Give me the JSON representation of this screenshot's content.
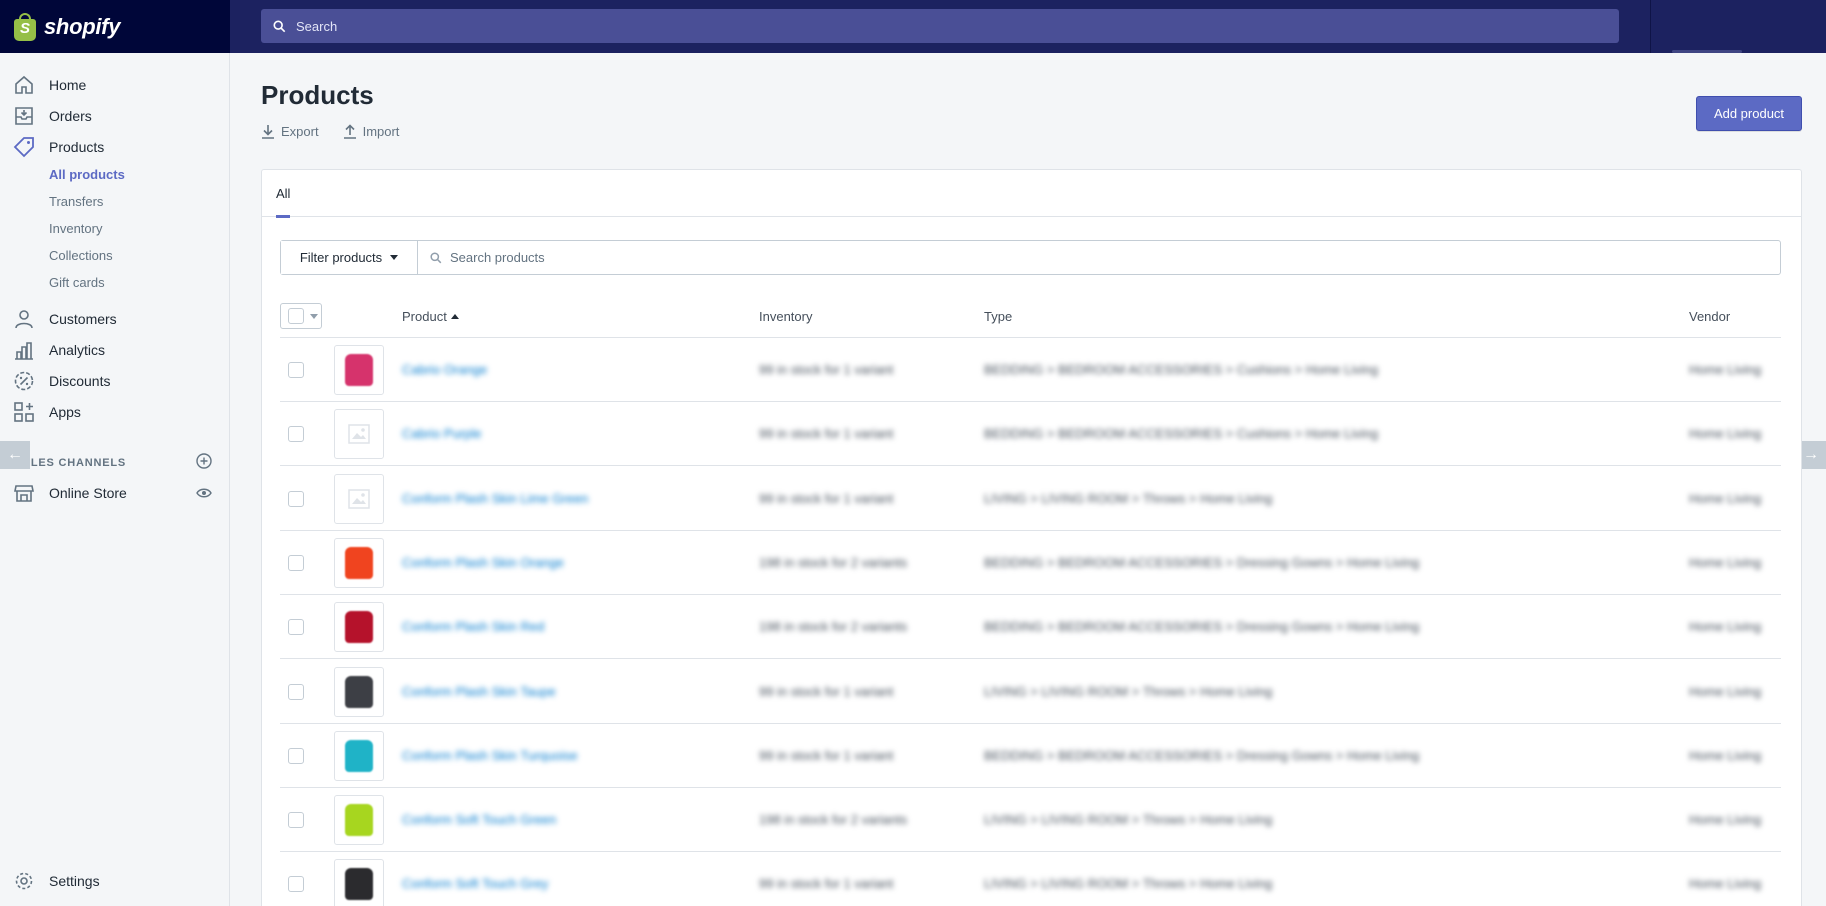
{
  "brand": {
    "name": "shopify",
    "logo_letter": "S"
  },
  "top_search": {
    "placeholder": "Search"
  },
  "sidebar": {
    "items": [
      {
        "label": "Home",
        "icon": "home-icon"
      },
      {
        "label": "Orders",
        "icon": "orders-icon"
      },
      {
        "label": "Products",
        "icon": "tag-icon"
      },
      {
        "label": "Customers",
        "icon": "person-icon"
      },
      {
        "label": "Analytics",
        "icon": "bar-chart-icon"
      },
      {
        "label": "Discounts",
        "icon": "discount-icon"
      },
      {
        "label": "Apps",
        "icon": "apps-icon"
      }
    ],
    "product_subitems": [
      "All products",
      "Transfers",
      "Inventory",
      "Collections",
      "Gift cards"
    ],
    "sales_channels_title": "SALES CHANNELS",
    "online_store": "Online Store",
    "settings": "Settings"
  },
  "page": {
    "title": "Products",
    "export_label": "Export",
    "import_label": "Import",
    "add_button": "Add product",
    "tab_all": "All",
    "filter_label": "Filter products",
    "search_placeholder": "Search products"
  },
  "table": {
    "headers": {
      "product": "Product",
      "inventory": "Inventory",
      "type": "Type",
      "vendor": "Vendor"
    },
    "rows": [
      {
        "name": "Cabrio Orange",
        "inventory": "99 in stock for 1 variant",
        "type": "BEDDING > BEDROOM ACCESSORIES > Cushions > Home Living",
        "vendor": "Home Living",
        "thumb_color": "#d6336c"
      },
      {
        "name": "Cabrio Purple",
        "inventory": "99 in stock for 1 variant",
        "type": "BEDDING > BEDROOM ACCESSORIES > Cushions > Home Living",
        "vendor": "Home Living",
        "thumb_color": ""
      },
      {
        "name": "Conform Plash Skin Lime Green",
        "inventory": "99 in stock for 1 variant",
        "type": "LIVING > LIVING ROOM > Throws > Home Living",
        "vendor": "Home Living",
        "thumb_color": ""
      },
      {
        "name": "Conform Plash Skin Orange",
        "inventory": "198 in stock for 2 variants",
        "type": "BEDDING > BEDROOM ACCESSORIES > Dressing Gowns > Home Living",
        "vendor": "Home Living",
        "thumb_color": "#f0441f"
      },
      {
        "name": "Conform Plash Skin Red",
        "inventory": "198 in stock for 2 variants",
        "type": "BEDDING > BEDROOM ACCESSORIES > Dressing Gowns > Home Living",
        "vendor": "Home Living",
        "thumb_color": "#b5122b"
      },
      {
        "name": "Conform Plash Skin Taupe",
        "inventory": "99 in stock for 1 variant",
        "type": "LIVING > LIVING ROOM > Throws > Home Living",
        "vendor": "Home Living",
        "thumb_color": "#3d3f45"
      },
      {
        "name": "Conform Plash Skin Turquoise",
        "inventory": "99 in stock for 1 variant",
        "type": "BEDDING > BEDROOM ACCESSORIES > Dressing Gowns > Home Living",
        "vendor": "Home Living",
        "thumb_color": "#1fb3c7"
      },
      {
        "name": "Conform Soft Touch Green",
        "inventory": "198 in stock for 2 variants",
        "type": "LIVING > LIVING ROOM > Throws > Home Living",
        "vendor": "Home Living",
        "thumb_color": "#a7d61f"
      },
      {
        "name": "Conform Soft Touch Grey",
        "inventory": "99 in stock for 1 variant",
        "type": "LIVING > LIVING ROOM > Throws > Home Living",
        "vendor": "Home Living",
        "thumb_color": "#2b2b2e"
      }
    ]
  },
  "colors": {
    "topbar": "#1c2260",
    "brand_bg": "#000639",
    "accent": "#5c6ac4",
    "link": "#007ace",
    "logo_green": "#95bf47"
  }
}
